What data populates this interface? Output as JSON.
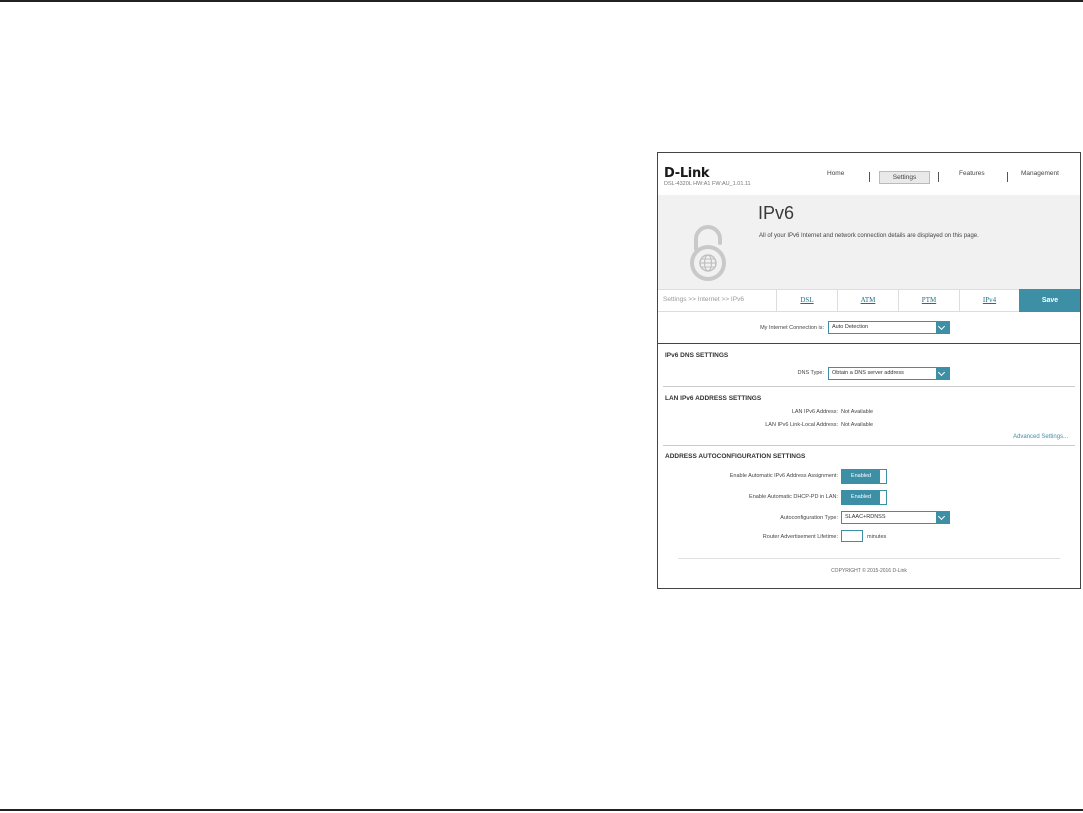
{
  "brand": {
    "logo": "D-Link",
    "model_line": "DSL-4320L   HW:A1   FW:AU_1.01.11"
  },
  "nav": {
    "home": "Home",
    "settings": "Settings",
    "features": "Features",
    "management": "Management"
  },
  "banner": {
    "title": "IPv6",
    "description": "All of your IPv6 Internet and network connection details are displayed on this page."
  },
  "tabs": {
    "breadcrumb": "Settings >> Internet >> IPv6",
    "items": [
      "DSL",
      "ATM",
      "PTM",
      "IPv4"
    ],
    "save_label": "Save"
  },
  "connection": {
    "label": "My Internet Connection is:",
    "value": "Auto Detection"
  },
  "dns": {
    "section_title": "IPv6 DNS SETTINGS",
    "type_label": "DNS Type:",
    "type_value": "Obtain a DNS server address"
  },
  "lan": {
    "section_title": "LAN IPv6 ADDRESS SETTINGS",
    "address_label": "LAN IPv6 Address:",
    "address_value": "Not Available",
    "linklocal_label": "LAN IPv6 Link-Local Address:",
    "linklocal_value": "Not Available",
    "advanced_link": "Advanced Settings..."
  },
  "autoconf": {
    "section_title": "ADDRESS AUTOCONFIGURATION SETTINGS",
    "auto_ipv6_label": "Enable Automatic IPv6 Address Assignment:",
    "auto_ipv6_state": "Enabled",
    "dhcp_pd_label": "Enable Automatic DHCP-PD in LAN:",
    "dhcp_pd_state": "Enabled",
    "type_label": "Autoconfiguration Type:",
    "type_value": "SLAAC+RDNSS",
    "lifetime_label": "Router Advertisement Lifetime:",
    "lifetime_value": "",
    "lifetime_unit": "minutes"
  },
  "footer": {
    "copyright": "COPYRIGHT © 2015-2016 D-Link"
  },
  "colors": {
    "accent": "#3d8fa6",
    "banner_bg": "#f1f1f1"
  }
}
